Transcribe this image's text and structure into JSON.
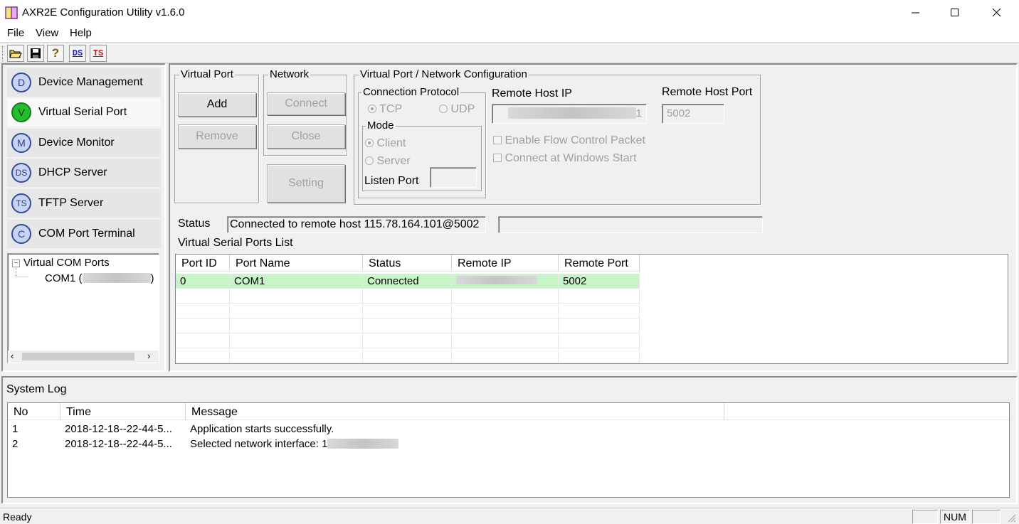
{
  "window": {
    "title": "AXR2E Configuration Utility v1.6.0",
    "minimize_icon": "minimize-icon",
    "maximize_icon": "maximize-icon",
    "close_icon": "close-icon"
  },
  "menu": [
    "File",
    "View",
    "Help"
  ],
  "toolbar": [
    {
      "name": "open-folder-icon",
      "label": ""
    },
    {
      "name": "save-icon",
      "label": ""
    },
    {
      "name": "help-icon",
      "label": "?"
    },
    {
      "name": "ds-icon",
      "label": "DS"
    },
    {
      "name": "ts-icon",
      "label": "TS"
    }
  ],
  "nav": [
    {
      "letter": "D",
      "label": "Device Management"
    },
    {
      "letter": "V",
      "label": "Virtual Serial Port"
    },
    {
      "letter": "M",
      "label": "Device Monitor"
    },
    {
      "letter": "DS",
      "label": "DHCP Server"
    },
    {
      "letter": "TS",
      "label": "TFTP Server"
    },
    {
      "letter": "C",
      "label": "COM Port Terminal"
    }
  ],
  "tree": {
    "root": "Virtual COM Ports",
    "child": "COM1 (",
    "child_suffix": ")"
  },
  "virtual_port": {
    "legend": "Virtual Port",
    "add": "Add",
    "remove": "Remove"
  },
  "network": {
    "legend": "Network",
    "connect": "Connect",
    "close": "Close",
    "setting": "Setting"
  },
  "config": {
    "legend": "Virtual Port / Network Configuration",
    "protocol_legend": "Connection Protocol",
    "tcp": "TCP",
    "udp": "UDP",
    "mode_legend": "Mode",
    "client": "Client",
    "server": "Server",
    "listen_port": "Listen Port",
    "listen_port_value": "",
    "remote_host_ip": "Remote Host IP",
    "remote_host_ip_value": "1",
    "remote_host_port": "Remote Host Port",
    "remote_host_port_value": "5002",
    "flow_control": "Enable Flow Control Packet",
    "connect_startup": "Connect at Windows Start"
  },
  "status": {
    "label": "Status",
    "value": "Connected to remote host 115.78.164.101@5002",
    "extra": ""
  },
  "ports_list": {
    "title": "Virtual Serial Ports List",
    "columns": [
      "Port ID",
      "Port Name",
      "Status",
      "Remote IP",
      "Remote Port"
    ],
    "rows": [
      {
        "port_id": "0",
        "port_name": "COM1",
        "status": "Connected",
        "remote_ip": "",
        "remote_port": "5002"
      }
    ]
  },
  "system_log": {
    "title": "System Log",
    "columns": [
      "No",
      "Time",
      "Message"
    ],
    "rows": [
      {
        "no": "1",
        "time": "2018-12-18--22-44-5...",
        "message": "Application starts successfully."
      },
      {
        "no": "2",
        "time": "2018-12-18--22-44-5...",
        "message": "Selected network interface: 1"
      }
    ]
  },
  "statusbar": {
    "text": "Ready",
    "num": "NUM"
  },
  "colors": {
    "selected_row": "#c8f5c8",
    "nav_circle": "#c8d4f2",
    "nav_circle_active": "#22c030"
  }
}
